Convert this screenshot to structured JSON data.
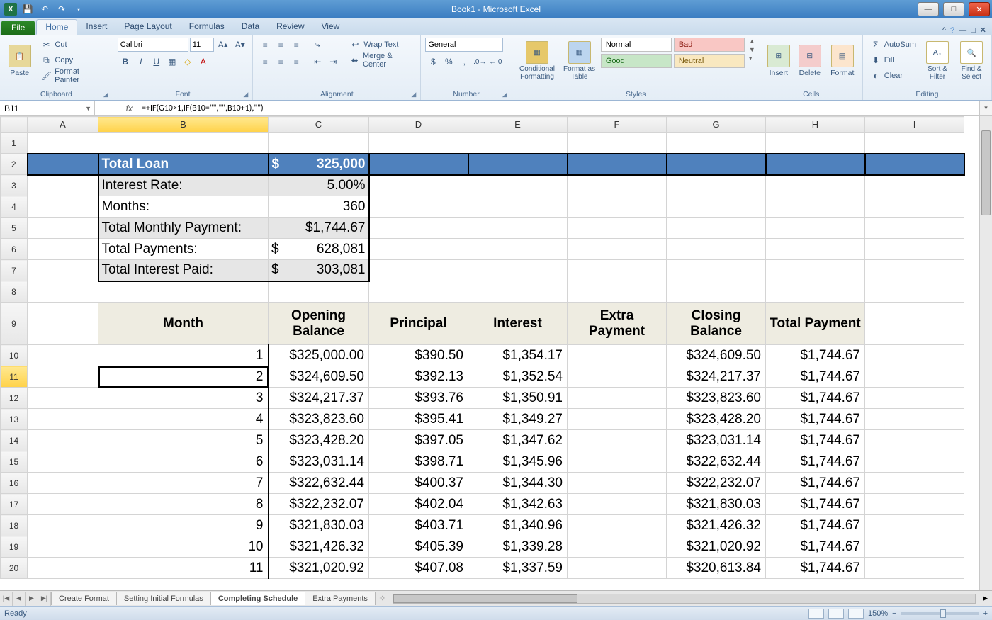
{
  "window": {
    "title": "Book1 - Microsoft Excel"
  },
  "tabs": {
    "file": "File",
    "items": [
      "Home",
      "Insert",
      "Page Layout",
      "Formulas",
      "Data",
      "Review",
      "View"
    ],
    "active": 0
  },
  "ribbon": {
    "clipboard": {
      "label": "Clipboard",
      "paste": "Paste",
      "cut": "Cut",
      "copy": "Copy ",
      "painter": "Format Painter"
    },
    "font": {
      "label": "Font",
      "name": "Calibri",
      "size": "11"
    },
    "alignment": {
      "label": "Alignment",
      "wrap": "Wrap Text",
      "merge": "Merge & Center "
    },
    "number": {
      "label": "Number",
      "format": "General"
    },
    "styles": {
      "label": "Styles",
      "cond": "Conditional Formatting ",
      "table": "Format as Table ",
      "normal": "Normal",
      "bad": "Bad",
      "good": "Good",
      "neutral": "Neutral"
    },
    "cells": {
      "label": "Cells",
      "insert": "Insert",
      "delete": "Delete",
      "format": "Format"
    },
    "editing": {
      "label": "Editing",
      "autosum": "AutoSum ",
      "fill": "Fill ",
      "clear": "Clear ",
      "sort": "Sort & Filter ",
      "find": "Find & Select "
    }
  },
  "namebox": "B11",
  "formula": "=+IF(G10>1,IF(B10=\"\",\"\",B10+1),\"\")",
  "columns": [
    "A",
    "B",
    "C",
    "D",
    "E",
    "F",
    "G",
    "H",
    "I"
  ],
  "selected": {
    "col": "B",
    "row": 11
  },
  "loan": {
    "title": "Total Loan",
    "amount_sym": "$",
    "amount": "325,000",
    "rows": [
      {
        "label": "Interest Rate:",
        "value": "5.00%",
        "alt": true
      },
      {
        "label": "Months:",
        "value": "360",
        "alt": false
      },
      {
        "label": "Total Monthly  Payment:",
        "value": "$1,744.67",
        "alt": true
      },
      {
        "label": "Total Payments:",
        "sym": "$",
        "value": "628,081",
        "alt": false
      },
      {
        "label": "Total Interest Paid:",
        "sym": "$",
        "value": "303,081",
        "alt": true
      }
    ]
  },
  "amort": {
    "headers": [
      "Month",
      "Opening Balance",
      "Principal",
      "Interest",
      "Extra Payment",
      "Closing Balance",
      "Total Payment"
    ],
    "rows": [
      {
        "r": 10,
        "m": "1",
        "ob": "$325,000.00",
        "p": "$390.50",
        "i": "$1,354.17",
        "e": "",
        "cb": "$324,609.50",
        "tp": "$1,744.67"
      },
      {
        "r": 11,
        "m": "2",
        "ob": "$324,609.50",
        "p": "$392.13",
        "i": "$1,352.54",
        "e": "",
        "cb": "$324,217.37",
        "tp": "$1,744.67"
      },
      {
        "r": 12,
        "m": "3",
        "ob": "$324,217.37",
        "p": "$393.76",
        "i": "$1,350.91",
        "e": "",
        "cb": "$323,823.60",
        "tp": "$1,744.67"
      },
      {
        "r": 13,
        "m": "4",
        "ob": "$323,823.60",
        "p": "$395.41",
        "i": "$1,349.27",
        "e": "",
        "cb": "$323,428.20",
        "tp": "$1,744.67"
      },
      {
        "r": 14,
        "m": "5",
        "ob": "$323,428.20",
        "p": "$397.05",
        "i": "$1,347.62",
        "e": "",
        "cb": "$323,031.14",
        "tp": "$1,744.67"
      },
      {
        "r": 15,
        "m": "6",
        "ob": "$323,031.14",
        "p": "$398.71",
        "i": "$1,345.96",
        "e": "",
        "cb": "$322,632.44",
        "tp": "$1,744.67"
      },
      {
        "r": 16,
        "m": "7",
        "ob": "$322,632.44",
        "p": "$400.37",
        "i": "$1,344.30",
        "e": "",
        "cb": "$322,232.07",
        "tp": "$1,744.67"
      },
      {
        "r": 17,
        "m": "8",
        "ob": "$322,232.07",
        "p": "$402.04",
        "i": "$1,342.63",
        "e": "",
        "cb": "$321,830.03",
        "tp": "$1,744.67"
      },
      {
        "r": 18,
        "m": "9",
        "ob": "$321,830.03",
        "p": "$403.71",
        "i": "$1,340.96",
        "e": "",
        "cb": "$321,426.32",
        "tp": "$1,744.67"
      },
      {
        "r": 19,
        "m": "10",
        "ob": "$321,426.32",
        "p": "$405.39",
        "i": "$1,339.28",
        "e": "",
        "cb": "$321,020.92",
        "tp": "$1,744.67"
      },
      {
        "r": 20,
        "m": "11",
        "ob": "$321,020.92",
        "p": "$407.08",
        "i": "$1,337.59",
        "e": "",
        "cb": "$320,613.84",
        "tp": "$1,744.67"
      }
    ]
  },
  "sheetTabs": {
    "items": [
      "Create Format",
      "Setting Initial Formulas",
      "Completing Schedule",
      "Extra Payments"
    ],
    "active": 2
  },
  "status": {
    "ready": "Ready",
    "zoom": "150%"
  }
}
